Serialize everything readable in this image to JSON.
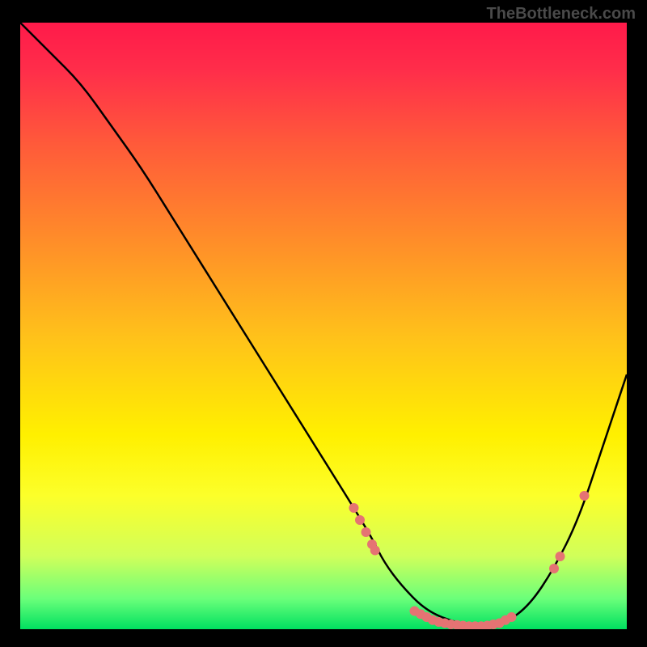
{
  "watermark": "TheBottleneck.com",
  "chart_data": {
    "type": "line",
    "title": "",
    "xlabel": "",
    "ylabel": "",
    "xlim": [
      0,
      100
    ],
    "ylim": [
      0,
      100
    ],
    "curve": {
      "x": [
        0,
        5,
        10,
        15,
        20,
        25,
        30,
        35,
        40,
        45,
        50,
        55,
        58,
        60,
        63,
        67,
        72,
        76,
        80,
        84,
        88,
        92,
        96,
        100
      ],
      "y": [
        100,
        95,
        90,
        83,
        76,
        68,
        60,
        52,
        44,
        36,
        28,
        20,
        15,
        11,
        7,
        3,
        1,
        0.5,
        1,
        4,
        10,
        18,
        30,
        42
      ]
    },
    "points": [
      {
        "x": 55,
        "y": 20
      },
      {
        "x": 56,
        "y": 18
      },
      {
        "x": 57,
        "y": 16
      },
      {
        "x": 58,
        "y": 14
      },
      {
        "x": 58.5,
        "y": 13
      },
      {
        "x": 65,
        "y": 3
      },
      {
        "x": 66,
        "y": 2.5
      },
      {
        "x": 67,
        "y": 2
      },
      {
        "x": 68,
        "y": 1.5
      },
      {
        "x": 69,
        "y": 1.2
      },
      {
        "x": 70,
        "y": 1
      },
      {
        "x": 71,
        "y": 0.8
      },
      {
        "x": 72,
        "y": 0.7
      },
      {
        "x": 73,
        "y": 0.6
      },
      {
        "x": 74,
        "y": 0.5
      },
      {
        "x": 75,
        "y": 0.5
      },
      {
        "x": 76,
        "y": 0.5
      },
      {
        "x": 77,
        "y": 0.6
      },
      {
        "x": 78,
        "y": 0.8
      },
      {
        "x": 79,
        "y": 1
      },
      {
        "x": 80,
        "y": 1.5
      },
      {
        "x": 81,
        "y": 2
      },
      {
        "x": 88,
        "y": 10
      },
      {
        "x": 89,
        "y": 12
      },
      {
        "x": 93,
        "y": 22
      }
    ],
    "point_color": "#e57373",
    "curve_color": "#000000"
  }
}
